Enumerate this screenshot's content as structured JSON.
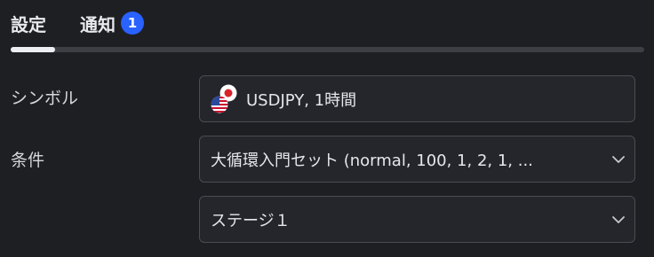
{
  "tabs": [
    {
      "label": "設定"
    },
    {
      "label": "通知",
      "badge": "1"
    }
  ],
  "progress": {
    "fraction": 0.07
  },
  "symbol": {
    "label": "シンボル",
    "value": "USDJPY, 1時間",
    "icons": [
      "us-flag-icon",
      "japan-flag-icon"
    ]
  },
  "condition": {
    "label": "条件",
    "value": "大循環入門セット (normal, 100, 1, 2, 1, ...",
    "stage_value": "ステージ１"
  },
  "colors": {
    "accent": "#2962ff",
    "background": "#1e1f23"
  }
}
